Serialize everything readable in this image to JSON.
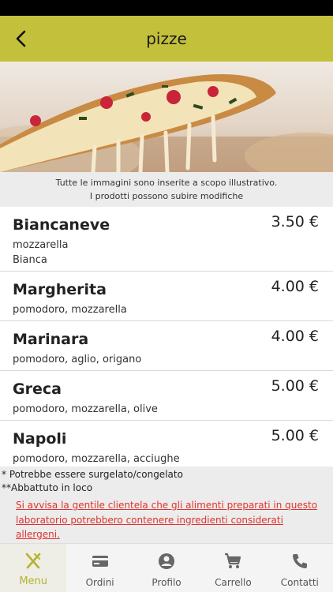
{
  "header": {
    "title": "pizze"
  },
  "disclaimer": {
    "line1": "Tutte le immagini sono inserite a scopo illustrativo.",
    "line2": "I prodotti possono subire modifiche"
  },
  "menu": {
    "items": [
      {
        "name": "Biancaneve",
        "price": "3.50 €",
        "desc1": "mozzarella",
        "desc2": "Bianca"
      },
      {
        "name": "Margherita",
        "price": "4.00 €",
        "desc1": "pomodoro, mozzarella"
      },
      {
        "name": "Marinara",
        "price": "4.00 €",
        "desc1": "pomodoro, aglio, origano"
      },
      {
        "name": "Greca",
        "price": "5.00 €",
        "desc1": "pomodoro, mozzarella, olive"
      },
      {
        "name": "Napoli",
        "price": "5.00 €",
        "desc1": "pomodoro, mozzarella, acciughe"
      }
    ]
  },
  "notes": {
    "frozen": "* Potrebbe essere surgelato/congelato",
    "blast": "**Abbattuto in loco",
    "allergen_line1": "Si avvisa la gentile clientela che gli alimenti preparati in questo",
    "allergen_line2": "laboratorio potrebbero contenere ingredienti considerati",
    "allergen_line3": "allergeni."
  },
  "tabs": [
    {
      "label": "Menu",
      "icon": "fork-knife-icon"
    },
    {
      "label": "Ordini",
      "icon": "credit-card-icon"
    },
    {
      "label": "Profilo",
      "icon": "user-circle-icon"
    },
    {
      "label": "Carrello",
      "icon": "cart-icon"
    },
    {
      "label": "Contatti",
      "icon": "phone-icon"
    }
  ],
  "colors": {
    "accent": "#c3c03c",
    "allergen": "#e0322d"
  }
}
